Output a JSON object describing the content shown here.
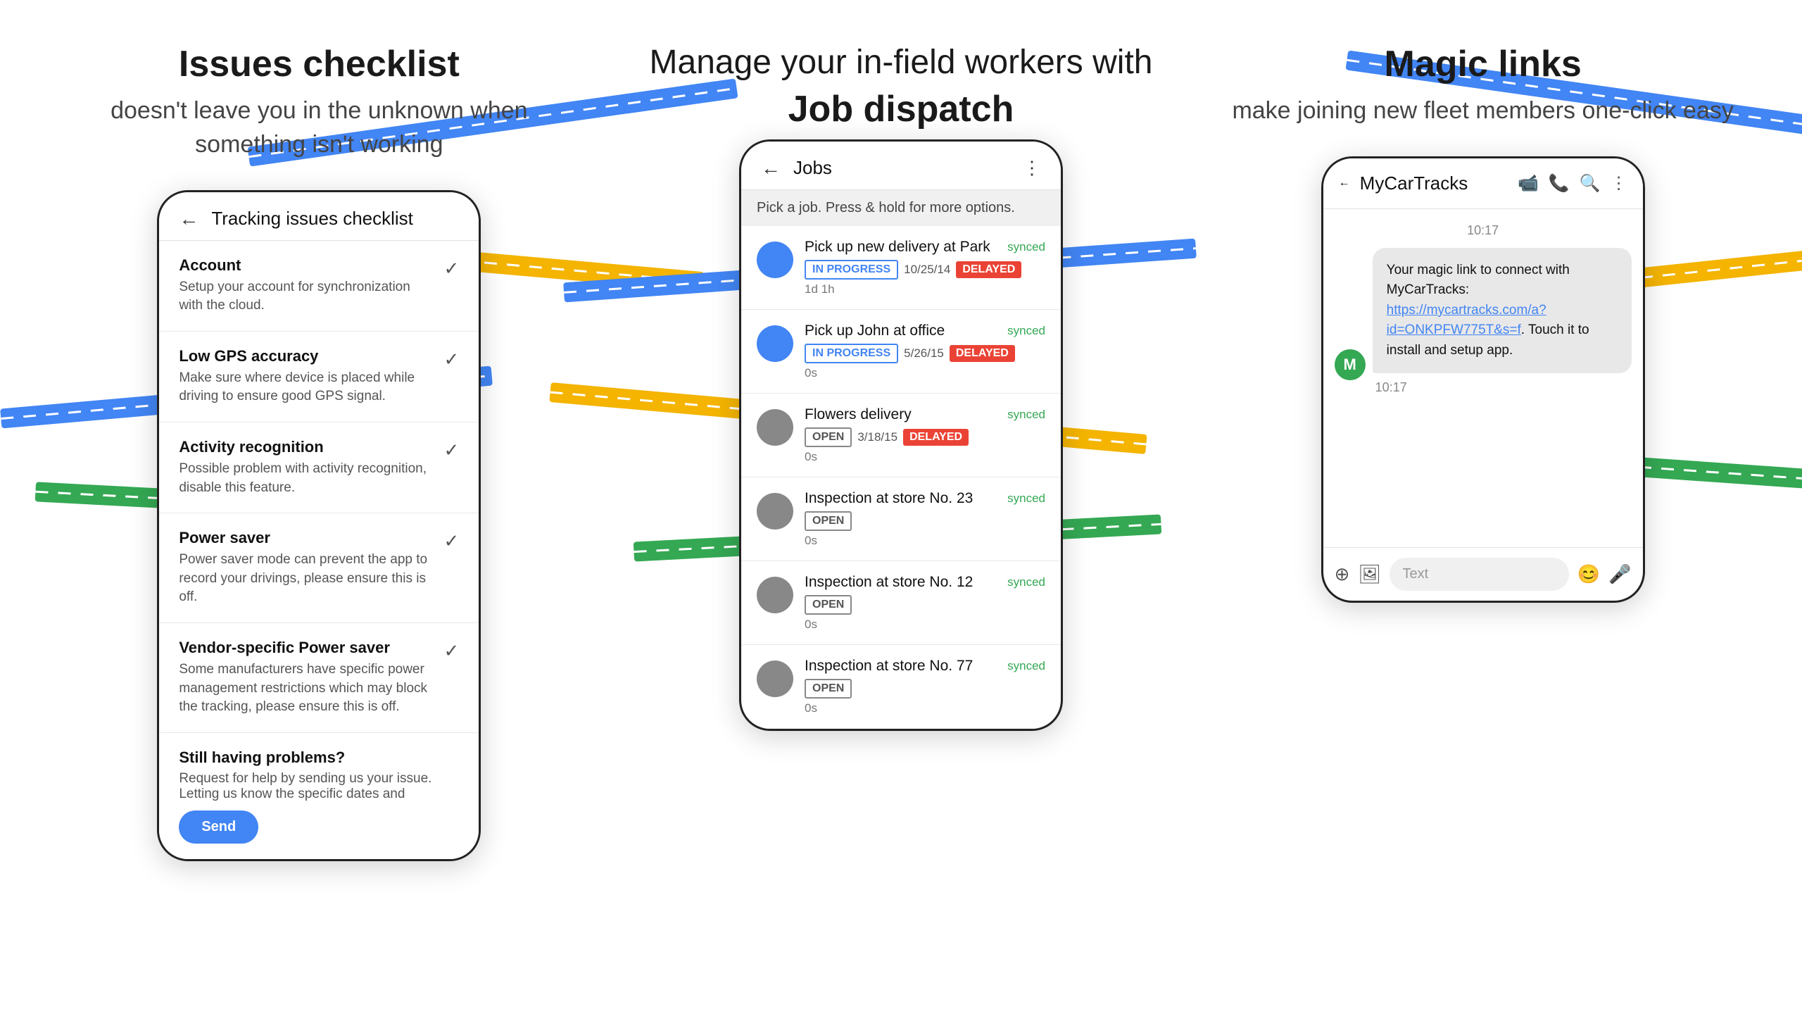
{
  "columns": {
    "checklist": {
      "heading_bold": "Issues checklist",
      "subheading": "doesn't leave you in the unknown\nwhen something isn't working",
      "phone": {
        "back_label": "←",
        "title": "Tracking issues checklist",
        "items": [
          {
            "title": "Account",
            "desc": "Setup your account for synchronization with the cloud.",
            "checked": true
          },
          {
            "title": "Low GPS accuracy",
            "desc": "Make sure where device is placed while driving to ensure good GPS signal.",
            "checked": true
          },
          {
            "title": "Activity recognition",
            "desc": "Possible problem with activity recognition, disable this feature.",
            "checked": true
          },
          {
            "title": "Power saver",
            "desc": "Power saver mode can prevent the app to record your drivings, please ensure this is off.",
            "checked": true
          },
          {
            "title": "Vendor-specific Power saver",
            "desc": "Some manufacturers have specific power management restrictions which may block the tracking, please ensure this is off.",
            "checked": true
          },
          {
            "title": "Still having problems?",
            "desc": "Request for help by sending us your issue. Letting us know the specific dates and",
            "checked": false,
            "has_button": true,
            "button_label": "Send"
          }
        ]
      }
    },
    "jobs": {
      "heading_normal": "Manage your in-field workers with",
      "heading_bold": "Job dispatch",
      "phone": {
        "back_label": "←",
        "title": "Jobs",
        "more_icon": "⋮",
        "hint": "Pick a job. Press & hold for more options.",
        "jobs": [
          {
            "title": "Pick up new delivery at Park",
            "avatar_color": "blue",
            "synced": "synced",
            "status": "IN PROGRESS",
            "date": "10/25/14",
            "delayed": true,
            "time": "1d 1h"
          },
          {
            "title": "Pick up John at office",
            "avatar_color": "blue",
            "synced": "synced",
            "status": "IN PROGRESS",
            "date": "5/26/15",
            "delayed": true,
            "time": "0s"
          },
          {
            "title": "Flowers delivery",
            "avatar_color": "gray",
            "synced": "synced",
            "status": "OPEN",
            "date": "3/18/15",
            "delayed": true,
            "time": "0s"
          },
          {
            "title": "Inspection at store No. 23",
            "avatar_color": "gray",
            "synced": "synced",
            "status": "OPEN",
            "date": "",
            "delayed": false,
            "time": "0s"
          },
          {
            "title": "Inspection at store No. 12",
            "avatar_color": "gray",
            "synced": "synced",
            "status": "OPEN",
            "date": "",
            "delayed": false,
            "time": "0s"
          },
          {
            "title": "Inspection at store No. 77",
            "avatar_color": "gray",
            "synced": "synced",
            "status": "OPEN",
            "date": "",
            "delayed": false,
            "time": "0s"
          }
        ]
      }
    },
    "magic": {
      "heading_bold": "Magic links",
      "subheading": "make joining new fleet members\none-click easy",
      "phone": {
        "back_label": "←",
        "title": "MyCarTracks",
        "timestamp": "10:17",
        "message": "Your magic link to connect with MyCarTracks: https://mycartracks.com/a?id=ONKPFW775T&s=f. Touch it to install and setup app.",
        "message_link": "https://mycartracks.com/a?id=ONKPFW775T&s=f",
        "timestamp2": "10:17",
        "avatar_letter": "M",
        "input_placeholder": "Text"
      }
    }
  }
}
